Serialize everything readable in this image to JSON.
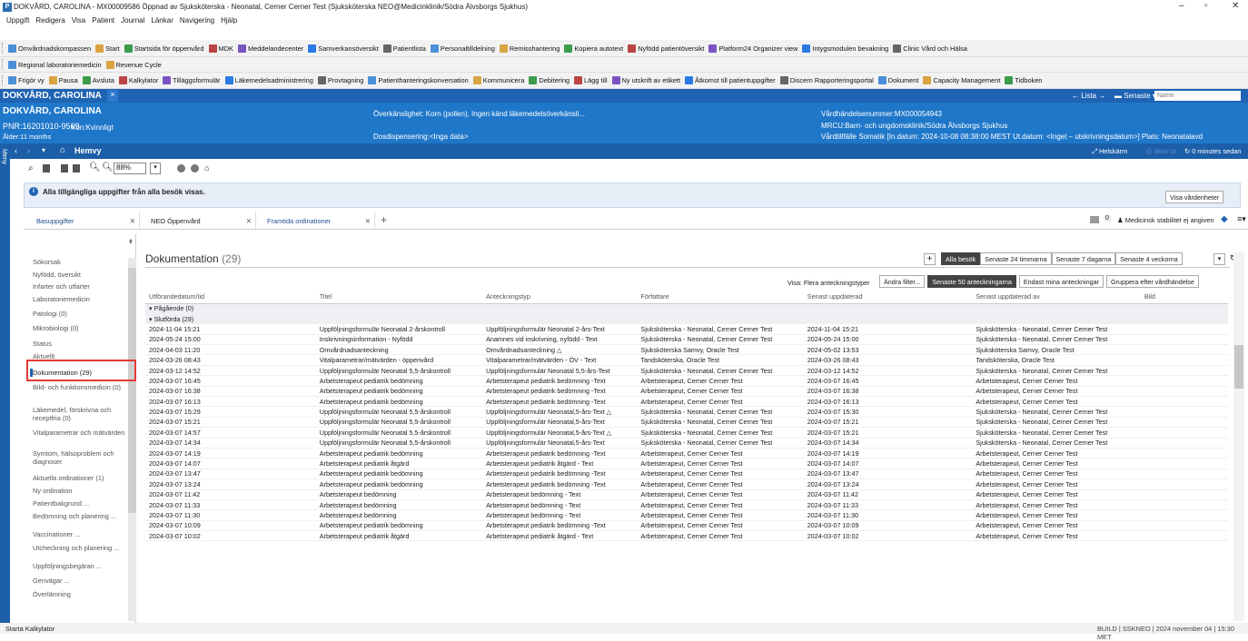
{
  "window": {
    "title": "DOKVÅRD, CAROLINA - MX00009586 Öppnad av Sjuksköterska - Neonatal, Cerner Cerner Test (Sjuksköterska NEO@Medicinklinik/Södra Älvsborgs Sjukhus)",
    "app_icon": "P"
  },
  "menu": [
    "Uppgift",
    "Redigera",
    "Visa",
    "Patient",
    "Journal",
    "Länkar",
    "Navigering",
    "Hjälp"
  ],
  "toolbar1": [
    "Omvårdnadskompassen",
    "Start",
    "Startsida för öppenvård",
    "MDK",
    "Meddelandecenter",
    "Samverkansöversikt",
    "Patientlista",
    "Personaltilldelning",
    "Remisshantering",
    "Kopiera autotext",
    "Nyfödd patientöversikt",
    "Platform24 Organizer view",
    "Intygsmodulen bevakning",
    "Clinic Vård och Hälsa"
  ],
  "toolbar2": [
    "Regional laboratoriemedicin",
    "Revenue Cycle"
  ],
  "toolbar3": [
    "Frigör vy",
    "Pausa",
    "Avsluta",
    "Kalkylator",
    "Tilläggsformulär",
    "Läkemedelsadministrering",
    "Provtagning",
    "Patienthanteringskonversation",
    "Kommunicera",
    "Debitering",
    "Lägg till",
    "Ny utskrift av etikett",
    "Åtkomst till patientuppgifter",
    "Discern Rapporteringsportal",
    "Dokument",
    "Capacity Management",
    "Tidboken"
  ],
  "patient_tab": {
    "name": "DOKVÅRD, CAROLINA",
    "close": "×",
    "lista": "Lista",
    "senaste": "Senaste",
    "search_placeholder": "Namn"
  },
  "patient": {
    "name": "DOKVÅRD, CAROLINA",
    "pnr": "PNR:16201010-9569",
    "age": "Ålder:11 months",
    "gender": "Kön:Kvinnligt",
    "allergy": "Överkänslighet: Korn (pollen), Ingen känd läkemedelsöverkänsli...",
    "dose": "Dosdispensering:<Inga data>",
    "event": "Vårdhändelsenummer:MX000054943",
    "mrcu": "MRCU:Barn- och ungdomsklinik/Södra Älvsborgs Sjukhus",
    "visit": "Vårdtillfälle Somatik [In.datum: 2024-10-08 08:38:00 MEST Ut.datum: <Inget – utskrivningsdatum>] Plats: Neonatalavd"
  },
  "nav": {
    "home": "Hemvy",
    "menu_label": "Meny",
    "fullscreen": "Helskärm",
    "print": "Skriv ut",
    "refresh": "0 minutes sedan"
  },
  "zoom": "88%",
  "info": {
    "text": "Alla tillgängliga uppgifter från alla besök visas.",
    "button": "Visa vårdenheter"
  },
  "tabs": [
    {
      "label": "Basuppgifter"
    },
    {
      "label": "NEO Öppenvård"
    },
    {
      "label": "Framtida ordinationer"
    }
  ],
  "tab_right": {
    "count": "0",
    "stability": "Medicinsk stabilitet ej angiven"
  },
  "sidebar": [
    "Sökorsak",
    "Nyfödd, översikt",
    "Infarter och utfarter",
    "Laboratoriemedicin",
    "Patologi (0)",
    "Mikrobiologi (0)",
    "Status",
    "Aktuellt",
    "Dokumentation (29)",
    "Bild- och funktionsmedicin (0)",
    "Läkemedel, förskrivna och receptfria (0)",
    "Vitalparametrar och mätvärden",
    "Symtom, hälsoproblem och diagnoser",
    "Aktuella ordinationer (1)",
    "Ny ordination",
    "Patientbakgrund ...",
    "Bedömning och planering ...",
    "Vaccinationer ...",
    "Utcheckning och planering ...",
    "Uppföljningsbegäran ...",
    "Genvägar ...",
    "Överlämning"
  ],
  "doc": {
    "title": "Dokumentation",
    "count": "(29)",
    "filters": [
      "Alla besök",
      "Senaste 24 timmarna",
      "Senaste 7 dagarna",
      "Senaste 4 veckorna"
    ],
    "visa": "Visa: Flera anteckningstyper",
    "buttons": [
      "Ändra filter...",
      "Senaste 50 anteckningarna",
      "Endast mina anteckningar",
      "Gruppera efter vårdhändelse"
    ],
    "columns": [
      "Utförandedatum/tid",
      "Titel",
      "Anteckningstyp",
      "Författare",
      "Senast uppdaterad",
      "Senast uppdaterad av",
      "Bild"
    ],
    "group_pending": "Pågående (0)",
    "group_done": "Slutförda (29)",
    "rows": [
      [
        "2024-11-04 15:21",
        "Uppföljningsformulär Neonatal 2-årskontroll",
        "Uppföljningsformulär Neonatal 2-års-Text",
        "Sjuksköterska - Neonatal, Cerner Cerner Test",
        "2024-11-04 15:21",
        "Sjuksköterska - Neonatal, Cerner Cerner Test"
      ],
      [
        "2024-05-24 15:00",
        "Inskrivningsinformation - Nyfödd",
        "Anamnes vid inskrivning, nyfödd - Text",
        "Sjuksköterska - Neonatal, Cerner Cerner Test",
        "2024-05-24 15:00",
        "Sjuksköterska - Neonatal, Cerner Cerner Test"
      ],
      [
        "2024-04-03 11:20",
        "Omvårdnadsanteckning",
        "Omvårdnadsanteckning △",
        "Sjuksköterska Samvy, Oracle Test",
        "2024-05-02 13:53",
        "Sjuksköterska Samvy, Oracle Test"
      ],
      [
        "2024-03-26 08:43",
        "Vitalparametrar/mätvärden - öppenvård",
        "Vitalparametrar/mätvärden - ÖV - Text",
        "Tandsköterska, Oracle Test",
        "2024-03-26 08:43",
        "Tandsköterska, Oracle Test"
      ],
      [
        "2024-03-12 14:52",
        "Uppföljningsformulär Neonatal 5,5-årskontroll",
        "Uppföljningsformulär Neonatal 5,5-års-Text",
        "Sjuksköterska - Neonatal, Cerner Cerner Test",
        "2024-03-12 14:52",
        "Sjuksköterska - Neonatal, Cerner Cerner Test"
      ],
      [
        "2024-03-07 16:45",
        "Arbetsterapeut pediatrik bedömning",
        "Arbetsterapeut pediatrik bedömning -Text",
        "Arbetsterapeut, Cerner Cerner Test",
        "2024-03-07 16:45",
        "Arbetsterapeut, Cerner Cerner Test"
      ],
      [
        "2024-03-07 16:38",
        "Arbetsterapeut pediatrik bedömning",
        "Arbetsterapeut pediatrik bedömning -Text",
        "Arbetsterapeut, Cerner Cerner Test",
        "2024-03-07 16:38",
        "Arbetsterapeut, Cerner Cerner Test"
      ],
      [
        "2024-03-07 16:13",
        "Arbetsterapeut pediatrik bedömning",
        "Arbetsterapeut pediatrik bedömning -Text",
        "Arbetsterapeut, Cerner Cerner Test",
        "2024-03-07 16:13",
        "Arbetsterapeut, Cerner Cerner Test"
      ],
      [
        "2024-03-07 15:29",
        "Uppföljningsformulär Neonatal 5,5-årskontroll",
        "Uppföljningsformulär Neonatal,5-års-Text △",
        "Sjuksköterska - Neonatal, Cerner Cerner Test",
        "2024-03-07 15:30",
        "Sjuksköterska - Neonatal, Cerner Cerner Test"
      ],
      [
        "2024-03-07 15:21",
        "Uppföljningsformulär Neonatal 5,5-årskontroll",
        "Uppföljningsformulär Neonatal,5-års-Text",
        "Sjuksköterska - Neonatal, Cerner Cerner Test",
        "2024-03-07 15:21",
        "Sjuksköterska - Neonatal, Cerner Cerner Test"
      ],
      [
        "2024-03-07 14:57",
        "Uppföljningsformulär Neonatal 5,5-årskontroll",
        "Uppföljningsformulär Neonatal,5-års-Text △",
        "Sjuksköterska - Neonatal, Cerner Cerner Test",
        "2024-03-07 15:21",
        "Sjuksköterska - Neonatal, Cerner Cerner Test"
      ],
      [
        "2024-03-07 14:34",
        "Uppföljningsformulär Neonatal 5,5-årskontroll",
        "Uppföljningsformulär Neonatal,5-års-Text",
        "Sjuksköterska - Neonatal, Cerner Cerner Test",
        "2024-03-07 14:34",
        "Sjuksköterska - Neonatal, Cerner Cerner Test"
      ],
      [
        "2024-03-07 14:19",
        "Arbetsterapeut pediatrik bedömning",
        "Arbetsterapeut pediatrik bedömning -Text",
        "Arbetsterapeut, Cerner Cerner Test",
        "2024-03-07 14:19",
        "Arbetsterapeut, Cerner Cerner Test"
      ],
      [
        "2024-03-07 14:07",
        "Arbetsterapeut pediatrik åtgärd",
        "Arbetsterapeut pediatrik åtgärd - Text",
        "Arbetsterapeut, Cerner Cerner Test",
        "2024-03-07 14:07",
        "Arbetsterapeut, Cerner Cerner Test"
      ],
      [
        "2024-03-07 13:47",
        "Arbetsterapeut pediatrik bedömning",
        "Arbetsterapeut pediatrik bedömning -Text",
        "Arbetsterapeut, Cerner Cerner Test",
        "2024-03-07 13:47",
        "Arbetsterapeut, Cerner Cerner Test"
      ],
      [
        "2024-03-07 13:24",
        "Arbetsterapeut pediatrik bedömning",
        "Arbetsterapeut pediatrik bedömning -Text",
        "Arbetsterapeut, Cerner Cerner Test",
        "2024-03-07 13:24",
        "Arbetsterapeut, Cerner Cerner Test"
      ],
      [
        "2024-03-07 11:42",
        "Arbetsterapeut bedömning",
        "Arbetsterapeut bedömning - Text",
        "Arbetsterapeut, Cerner Cerner Test",
        "2024-03-07 11:42",
        "Arbetsterapeut, Cerner Cerner Test"
      ],
      [
        "2024-03-07 11:33",
        "Arbetsterapeut bedömning",
        "Arbetsterapeut bedömning - Text",
        "Arbetsterapeut, Cerner Cerner Test",
        "2024-03-07 11:33",
        "Arbetsterapeut, Cerner Cerner Test"
      ],
      [
        "2024-03-07 11:30",
        "Arbetsterapeut bedömning",
        "Arbetsterapeut bedömning - Text",
        "Arbetsterapeut, Cerner Cerner Test",
        "2024-03-07 11:30",
        "Arbetsterapeut, Cerner Cerner Test"
      ],
      [
        "2024-03-07 10:09",
        "Arbetsterapeut pediatrik bedömning",
        "Arbetsterapeut pediatrik bedömning -Text",
        "Arbetsterapeut, Cerner Cerner Test",
        "2024-03-07 10:09",
        "Arbetsterapeut, Cerner Cerner Test"
      ],
      [
        "2024-03-07 10:02",
        "Arbetsterapeut pediatrik åtgärd",
        "Arbetsterapeut pediatrik åtgärd - Text",
        "Arbetsterapeut, Cerner Cerner Test",
        "2024-03-07 10:02",
        "Arbetsterapeut, Cerner Cerner Test"
      ]
    ]
  },
  "status": {
    "left": "Starta Kalkylator",
    "build": "BUILD",
    "env": "SSKNEO",
    "date": "2024 november 04",
    "time": "15:30 MET"
  },
  "colors": {
    "patient_bar": "#1f63b3",
    "header": "#1f77c9",
    "highlight": "#e53935"
  }
}
